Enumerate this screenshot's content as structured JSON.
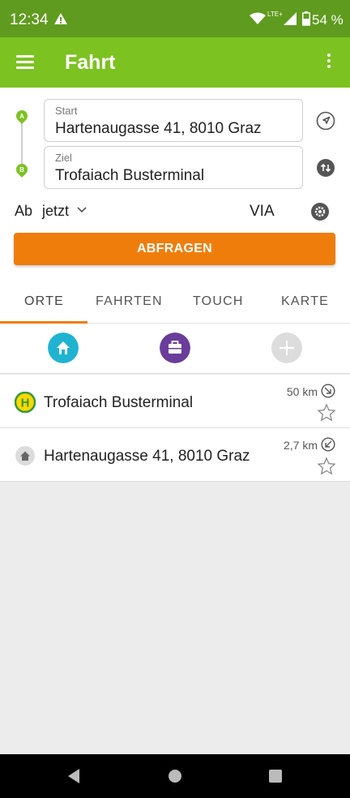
{
  "status_bar": {
    "time": "12:34",
    "network": "LTE+",
    "battery": "54 %"
  },
  "app_bar": {
    "title": "Fahrt",
    "icons": [
      "menu-icon",
      "more-vert-icon"
    ]
  },
  "form": {
    "start": {
      "label": "Start",
      "value": "Hartenaugasse 41, 8010 Graz",
      "pin": "A"
    },
    "ziel": {
      "label": "Ziel",
      "value": "Trofaiach Busterminal",
      "pin": "B"
    },
    "departure_label": "Ab",
    "departure_value": "jetzt",
    "via_label": "VIA",
    "submit_label": "ABFRAGEN",
    "icons": [
      "location-arrow-icon",
      "swap-icon",
      "settings-icon",
      "chevron-down-icon"
    ]
  },
  "tabs": [
    {
      "label": "ORTE",
      "active": true
    },
    {
      "label": "FAHRTEN",
      "active": false
    },
    {
      "label": "TOUCH",
      "active": false
    },
    {
      "label": "KARTE",
      "active": false
    }
  ],
  "favorites": [
    {
      "name": "home-icon",
      "color": "#1fb3d1"
    },
    {
      "name": "work-icon",
      "color": "#6a3d9a"
    },
    {
      "name": "add-icon",
      "color": "#dcdcdc"
    }
  ],
  "places": [
    {
      "name": "Trofaiach Busterminal",
      "distance": "50 km",
      "type": "bus-stop-icon"
    },
    {
      "name": "Hartenaugasse 41, 8010 Graz",
      "distance": "2,7 km",
      "type": "address-home-icon"
    }
  ],
  "colors": {
    "status_bar": "#5f9b1e",
    "app_bar": "#7cc221",
    "accent": "#ef7d0c",
    "pin": "#7cc221"
  }
}
